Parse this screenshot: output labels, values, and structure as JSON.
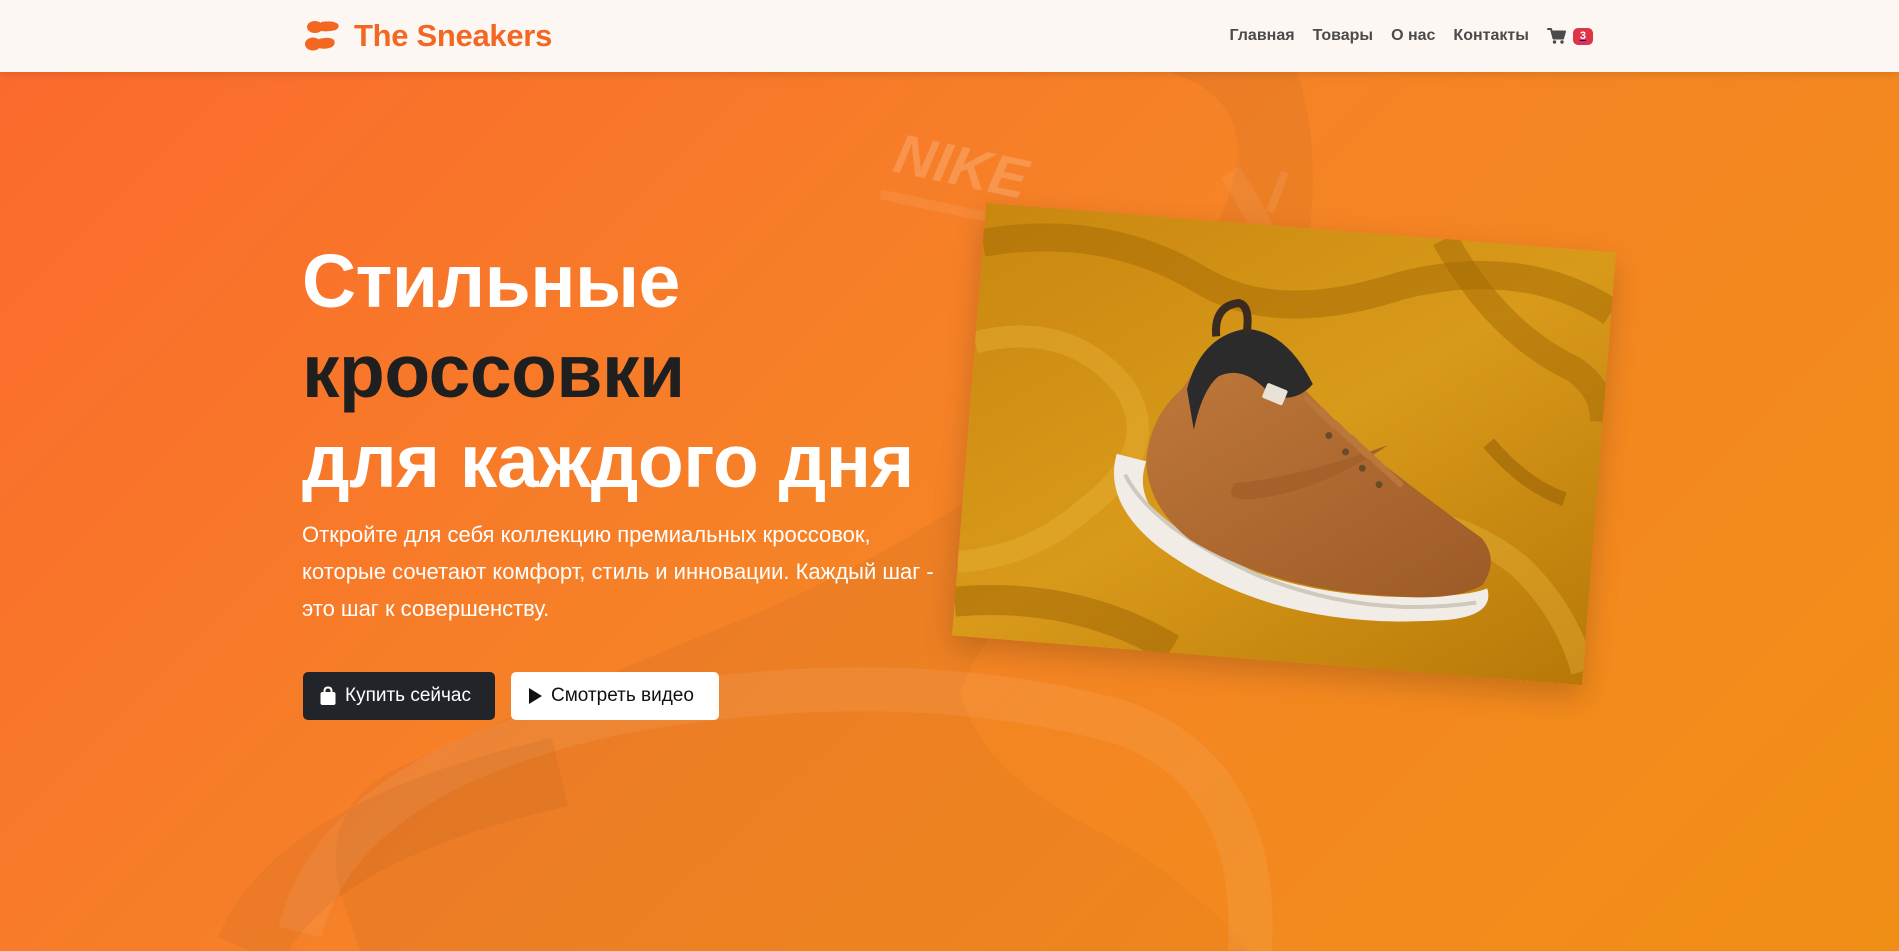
{
  "brand": {
    "name": "The Sneakers",
    "icon": "shoe-prints-icon",
    "color": "#f26722"
  },
  "nav": {
    "items": [
      {
        "label": "Главная"
      },
      {
        "label": "Товары"
      },
      {
        "label": "О нас"
      },
      {
        "label": "Контакты"
      }
    ],
    "cart": {
      "icon": "shopping-cart-icon",
      "count": "3",
      "badge_color": "#dc3545"
    }
  },
  "hero": {
    "title": {
      "line1": "Стильные",
      "line2": "кроссовки",
      "line3": "для каждого дня"
    },
    "description": "Откройте для себя коллекцию премиальных кроссовок, которые сочетают комфорт, стиль и инновации. Каждый шаг - это шаг к совершенству.",
    "buttons": {
      "buy": {
        "label": "Купить сейчас",
        "icon": "shopping-bag-icon"
      },
      "video": {
        "label": "Смотреть видео",
        "icon": "play-icon"
      }
    },
    "photo": {
      "icon": "sneaker-photo"
    },
    "background_logo": "NIKE"
  },
  "colors": {
    "accent": "#f26722",
    "dark": "#212529",
    "hero_start": "#fb6a2d",
    "hero_end": "#f08f16"
  }
}
